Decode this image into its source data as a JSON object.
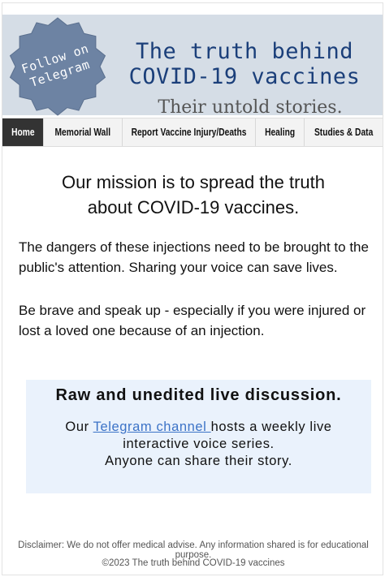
{
  "header": {
    "badge": {
      "line1": "Follow on",
      "line2": "Telegram",
      "color": "#6d83a3",
      "icon": "telegram-follow-badge"
    },
    "title_line1": "The truth behind",
    "title_line2": "COVID-19 vaccines",
    "tagline": "Their untold stories.",
    "title_color": "#1b3f7a",
    "background": "#d5dde6"
  },
  "nav": {
    "items": [
      {
        "label": "Home",
        "active": true
      },
      {
        "label": "Memorial Wall",
        "active": false
      },
      {
        "label": "Report Vaccine Injury/Deaths",
        "active": false
      },
      {
        "label": "Healing",
        "active": false
      },
      {
        "label": "Studies & Data",
        "active": false
      }
    ]
  },
  "main": {
    "mission_line1": "Our mission is to spread the truth",
    "mission_line2": "about COVID-19 vaccines.",
    "paragraph1": "The dangers of these injections need to be brought to the public's attention. Sharing your voice can save lives.",
    "paragraph2": "Be brave and speak up - especially if you were injured or lost a loved one because of an injection.",
    "callout": {
      "title": "Raw and unedited live discussion.",
      "text_before": "Our ",
      "link_text": "Telegram channel ",
      "text_after": "hosts a weekly live interactive voice series.",
      "line3": "Anyone can share their story.",
      "background": "#eaf2fc",
      "link_color": "#3c73c7"
    }
  },
  "footer": {
    "disclaimer": "Disclaimer: We do not offer medical advise. Any information shared is for educational purpose.",
    "copyright": "©2023 The truth behind COVID-19 vaccines"
  }
}
